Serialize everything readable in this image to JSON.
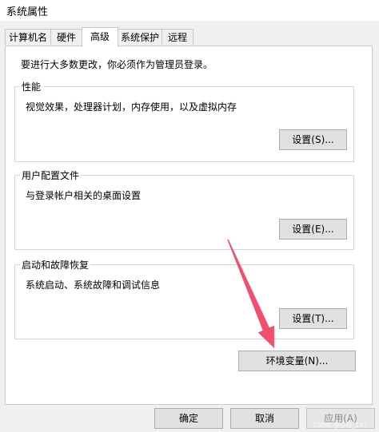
{
  "window": {
    "title": "系统属性"
  },
  "tabs": [
    {
      "label": "计算机名"
    },
    {
      "label": "硬件"
    },
    {
      "label": "高级"
    },
    {
      "label": "系统保护"
    },
    {
      "label": "远程"
    }
  ],
  "notice": "要进行大多数更改，你必须作为管理员登录。",
  "groups": {
    "performance": {
      "title": "性能",
      "description": "视觉效果，处理器计划，内存使用，以及虚拟内存",
      "button": "设置(S)..."
    },
    "user_profiles": {
      "title": "用户配置文件",
      "description": "与登录帐户相关的桌面设置",
      "button": "设置(E)..."
    },
    "startup_recovery": {
      "title": "启动和故障恢复",
      "description": "系统启动、系统故障和调试信息",
      "button": "设置(T)..."
    }
  },
  "env_button": "环境变量(N)...",
  "footer": {
    "ok": "确定",
    "cancel": "取消",
    "apply": "应用(A)"
  },
  "watermark": "CSDN @小白_147",
  "colors": {
    "arrow": "#f0506e",
    "panel_bg": "#ffffff",
    "window_bg": "#f0f0f0"
  }
}
